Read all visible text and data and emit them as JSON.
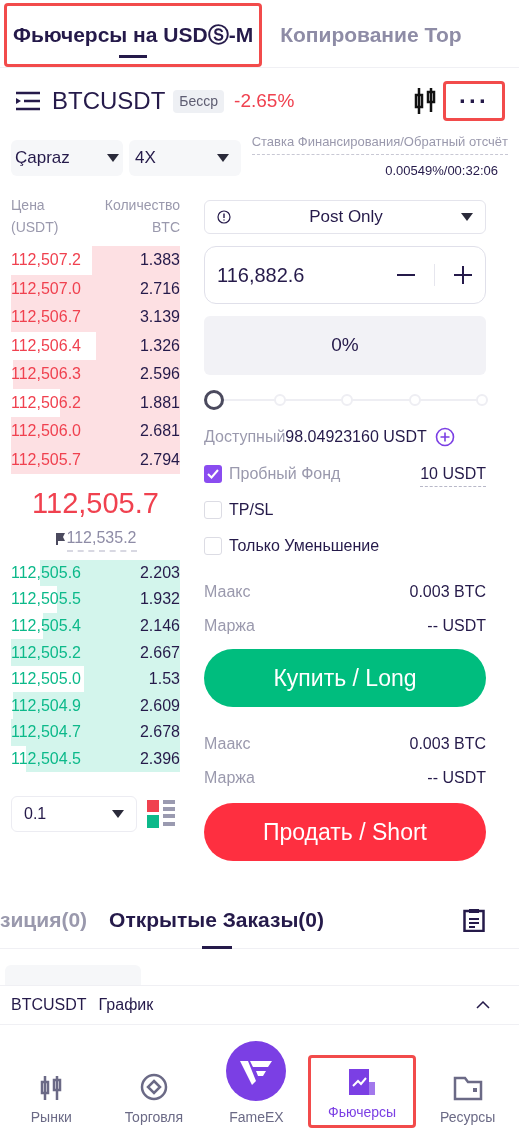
{
  "top_tabs": [
    {
      "label": "Фьючерсы на USDⓈ-M",
      "selected": true,
      "highlighted": true
    },
    {
      "label": "Копирование Тор",
      "selected": false,
      "highlighted": false
    }
  ],
  "header": {
    "symbol": "BTCUSDT",
    "badge": "Бесср",
    "change": "-2.65%",
    "more": "···",
    "more_highlighted": true
  },
  "margin_mode": "Çapraz",
  "leverage": "4X",
  "funding": {
    "label": "Ставка Финансирования/Обратный отсчёт",
    "value": "0.00549%/00:32:06"
  },
  "order_book": {
    "price_header": [
      "Цена",
      "(USDT)"
    ],
    "qty_header": [
      "Количество",
      "BTC"
    ],
    "asks": [
      {
        "price": "112,507.2",
        "qty": "1.383"
      },
      {
        "price": "112,507.0",
        "qty": "2.716"
      },
      {
        "price": "112,506.7",
        "qty": "3.139"
      },
      {
        "price": "112,506.4",
        "qty": "1.326"
      },
      {
        "price": "112,506.3",
        "qty": "2.596"
      },
      {
        "price": "112,506.2",
        "qty": "1.881"
      },
      {
        "price": "112,506.0",
        "qty": "2.681"
      },
      {
        "price": "112,505.7",
        "qty": "2.794"
      }
    ],
    "last_price": "112,505.7",
    "mark_price": "112,535.2",
    "bids": [
      {
        "price": "112,505.6",
        "qty": "2.203"
      },
      {
        "price": "112,505.5",
        "qty": "1.932"
      },
      {
        "price": "112,505.4",
        "qty": "2.146"
      },
      {
        "price": "112,505.2",
        "qty": "2.667"
      },
      {
        "price": "112,505.0",
        "qty": "1.53"
      },
      {
        "price": "112,504.9",
        "qty": "2.609"
      },
      {
        "price": "112,504.7",
        "qty": "2.678"
      },
      {
        "price": "112,504.5",
        "qty": "2.396"
      }
    ],
    "precision": "0.1"
  },
  "order_form": {
    "order_type": "Post Only",
    "price": "116,882.6",
    "percent": "0%",
    "level": 0,
    "available_label": "Доступный",
    "available_value": "98.04923160 USDT",
    "options": [
      {
        "label": "Пробный Фонд",
        "checked": true,
        "value": "10 USDT"
      },
      {
        "label": "TP/SL",
        "checked": false
      },
      {
        "label": "Только Уменьшение",
        "checked": false
      }
    ],
    "buy_info": [
      {
        "label": "Маакс",
        "value": "0.003 BTC"
      },
      {
        "label": "Маржа",
        "value": "-- USDT"
      }
    ],
    "buy_button": "Купить / Long",
    "sell_info": [
      {
        "label": "Маакс",
        "value": "0.003 BTC"
      },
      {
        "label": "Маржа",
        "value": "-- USDT"
      }
    ],
    "sell_button": "Продать / Short"
  },
  "bottom_tabs": [
    {
      "label": "зиция(0)",
      "selected": false
    },
    {
      "label": "Открытые Заказы(0)",
      "selected": true
    }
  ],
  "chart_bar": {
    "symbol": "BTCUSDT",
    "label": "График"
  },
  "nav": [
    {
      "label": "Рынки",
      "selected": false,
      "highlighted": false
    },
    {
      "label": "Торговля",
      "selected": false,
      "highlighted": false
    },
    {
      "label": "FameEX",
      "selected": false,
      "highlighted": false
    },
    {
      "label": "Фьючерсы",
      "selected": true,
      "highlighted": true
    },
    {
      "label": "Ресурсы",
      "selected": false,
      "highlighted": false
    }
  ]
}
